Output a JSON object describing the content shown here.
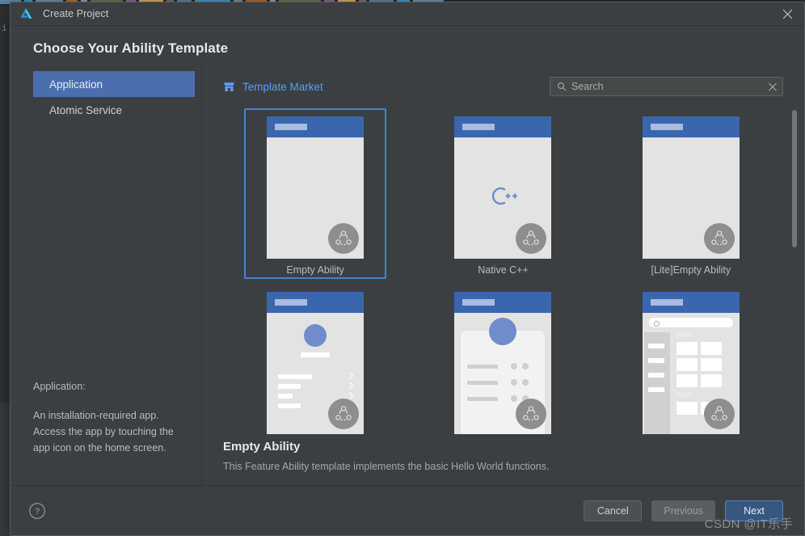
{
  "window": {
    "title": "Create Project",
    "logo_icon": "deveco-triangle-logo",
    "close_icon": "close-icon"
  },
  "backdrop": {
    "gutter_text": "i",
    "code_colors": [
      "#6897bb",
      "#4eade5",
      "#7aa6c2",
      "#cc7832",
      "#a9b7c6",
      "#6a8759",
      "#9876aa",
      "#ffc66d",
      "#808080"
    ]
  },
  "heading": "Choose Your Ability Template",
  "sidebar": {
    "items": [
      {
        "label": "Application",
        "selected": true
      },
      {
        "label": "Atomic Service",
        "selected": false
      }
    ],
    "description": {
      "title": "Application:",
      "body": "An installation-required app. Access the app by touching the app icon on the home screen."
    }
  },
  "toolbar": {
    "market_label": "Template Market",
    "market_icon": "store-icon",
    "search": {
      "placeholder": "Search",
      "value": "",
      "search_icon": "search-icon",
      "clear_icon": "clear-icon"
    }
  },
  "templates": [
    {
      "label": "Empty Ability",
      "selected": true,
      "variant": "blank",
      "badge_icon": "distributed-icon"
    },
    {
      "label": "Native C++",
      "selected": false,
      "variant": "cpp",
      "badge_icon": "distributed-icon"
    },
    {
      "label": "[Lite]Empty Ability",
      "selected": false,
      "variant": "blank",
      "badge_icon": "distributed-icon"
    },
    {
      "label": "",
      "selected": false,
      "variant": "profile",
      "badge_icon": "distributed-icon"
    },
    {
      "label": "",
      "selected": false,
      "variant": "cardlist",
      "badge_icon": "distributed-icon"
    },
    {
      "label": "",
      "selected": false,
      "variant": "catalog",
      "badge_icon": "distributed-icon"
    }
  ],
  "selection": {
    "title": "Empty Ability",
    "description": "This Feature Ability template implements the basic Hello World functions."
  },
  "footer": {
    "help_icon": "help-circle-icon",
    "cancel_label": "Cancel",
    "previous_label": "Previous",
    "next_label": "Next"
  },
  "watermark": "CSDN @IT乐手",
  "colors": {
    "accent": "#4b6eaf",
    "link": "#589df6",
    "primary_button": "#365880",
    "primary_button_border": "#4c84c4",
    "dialog_bg": "#3c3f41",
    "thumb_bg": "#e3e3e3",
    "thumb_header": "#3a66ae",
    "selected_border": "#3f84d2"
  }
}
